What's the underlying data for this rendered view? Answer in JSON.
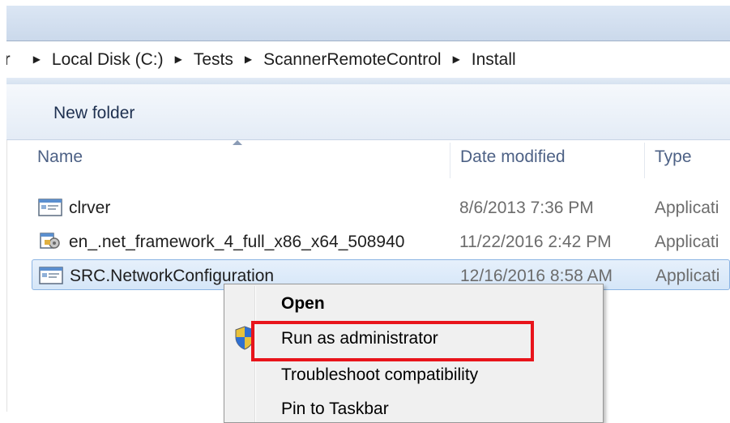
{
  "breadcrumb": {
    "edge": "er",
    "items": [
      "Local Disk (C:)",
      "Tests",
      "ScannerRemoteControl",
      "Install"
    ],
    "separator": "▶"
  },
  "toolbar": {
    "new_folder_label": "New folder"
  },
  "columns": {
    "name": "Name",
    "date_modified": "Date modified",
    "type": "Type"
  },
  "files": [
    {
      "name": "clrver",
      "date": "8/6/2013 7:36 PM",
      "type": "Applicati",
      "icon": "application-window-icon",
      "selected": false
    },
    {
      "name": "en_.net_framework_4_full_x86_x64_508940",
      "date": "11/22/2016 2:42 PM",
      "type": "Applicati",
      "icon": "installer-icon",
      "selected": false
    },
    {
      "name": "SRC.NetworkConfiguration",
      "date": "12/16/2016 8:58 AM",
      "type": "Applicati",
      "icon": "application-window-icon",
      "selected": true
    }
  ],
  "context_menu": {
    "items": [
      {
        "label": "Open",
        "bold": true
      },
      {
        "label": "Run as administrator",
        "icon": "uac-shield-icon"
      },
      {
        "label": "Troubleshoot compatibility"
      },
      {
        "label": "Pin to Taskbar"
      }
    ]
  },
  "colors": {
    "highlight": "#e8141b",
    "selection": "#d5e6f8",
    "header_text": "#4d6185"
  }
}
